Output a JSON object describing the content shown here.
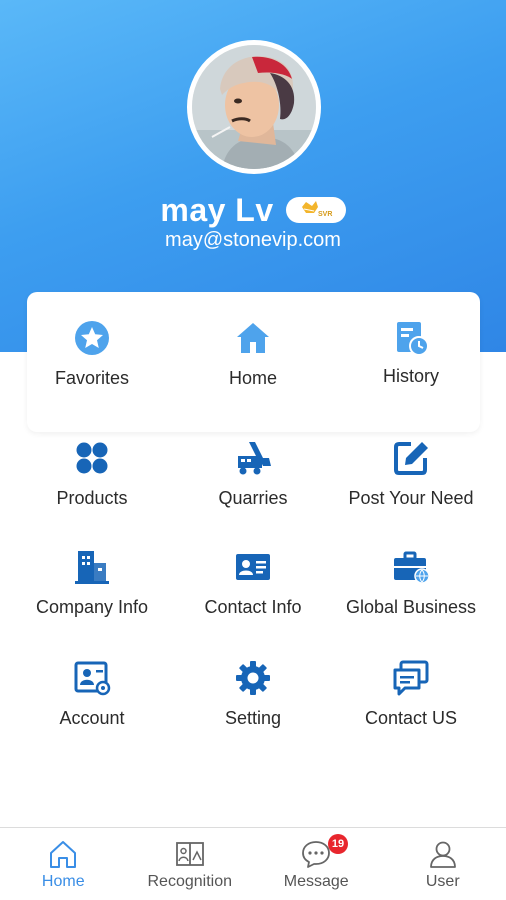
{
  "profile": {
    "name": "may Lv",
    "email": "may@stonevip.com",
    "badge_text": "SVR"
  },
  "colors": {
    "header_top": "#5ab8f8",
    "header_bottom": "#2f86e6",
    "icon_light": "#4ea3ec",
    "icon_dark": "#1765b7",
    "active_tab": "#3a8ee6",
    "badge": "#e8262d"
  },
  "menu": [
    {
      "label": "Favorites",
      "icon": "star-icon"
    },
    {
      "label": "Home",
      "icon": "home-icon"
    },
    {
      "label": "History",
      "icon": "history-icon"
    },
    {
      "label": "Products",
      "icon": "products-icon"
    },
    {
      "label": "Quarries",
      "icon": "quarries-icon"
    },
    {
      "label": "Post Your Need",
      "icon": "edit-icon"
    },
    {
      "label": "Company Info",
      "icon": "building-icon"
    },
    {
      "label": "Contact Info",
      "icon": "id-card-icon"
    },
    {
      "label": "Global Business",
      "icon": "briefcase-icon"
    },
    {
      "label": "Account",
      "icon": "account-icon"
    },
    {
      "label": "Setting",
      "icon": "gear-icon"
    },
    {
      "label": "Contact US",
      "icon": "chat-icon"
    }
  ],
  "tabs": [
    {
      "label": "Home",
      "icon": "home-outline-icon",
      "active": true
    },
    {
      "label": "Recognition",
      "icon": "recognition-icon"
    },
    {
      "label": "Message",
      "icon": "message-icon",
      "badge": "19"
    },
    {
      "label": "User",
      "icon": "user-icon"
    }
  ]
}
